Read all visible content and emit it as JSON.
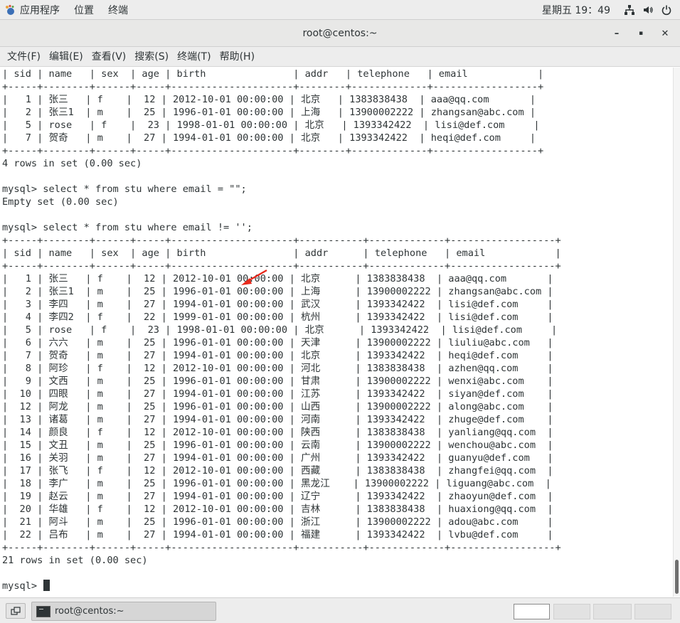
{
  "topbar": {
    "apps_label": "应用程序",
    "places_label": "位置",
    "terminal_label": "终端",
    "clock": "星期五 19：49"
  },
  "window": {
    "title": "root@centos:~",
    "minimize": "–",
    "maximize": "▪",
    "close": "✕"
  },
  "menubar": {
    "items": [
      "文件(F)",
      "编辑(E)",
      "查看(V)",
      "搜索(S)",
      "终端(T)",
      "帮助(H)"
    ]
  },
  "terminal": {
    "lines": [
      "| sid | name   | sex  | age | birth               | addr   | telephone   | email            |",
      "+-----+--------+------+-----+---------------------+--------+-------------+------------------+",
      "|   1 | 张三   | f    |  12 | 2012-10-01 00:00:00 | 北京   | 1383838438  | aaa@qq.com       |",
      "|   2 | 张三1  | m    |  25 | 1996-01-01 00:00:00 | 上海   | 13900002222 | zhangsan@abc.com |",
      "|   5 | rose   | f    |  23 | 1998-01-01 00:00:00 | 北京   | 1393342422  | lisi@def.com     |",
      "|   7 | 贺奇   | m    |  27 | 1994-01-01 00:00:00 | 北京   | 1393342422  | heqi@def.com     |",
      "+-----+--------+------+-----+---------------------+--------+-------------+------------------+",
      "4 rows in set (0.00 sec)",
      "",
      "mysql> select * from stu where email = \"\";",
      "Empty set (0.00 sec)",
      "",
      "mysql> select * from stu where email != '';",
      "+-----+--------+------+-----+---------------------+-----------+-------------+------------------+",
      "| sid | name   | sex  | age | birth               | addr      | telephone   | email            |",
      "+-----+--------+------+-----+---------------------+-----------+-------------+------------------+",
      "|   1 | 张三   | f    |  12 | 2012-10-01 00:00:00 | 北京      | 1383838438  | aaa@qq.com       |",
      "|   2 | 张三1  | m    |  25 | 1996-01-01 00:00:00 | 上海      | 13900002222 | zhangsan@abc.com |",
      "|   3 | 李四   | m    |  27 | 1994-01-01 00:00:00 | 武汉      | 1393342422  | lisi@def.com     |",
      "|   4 | 李四2  | f    |  22 | 1999-01-01 00:00:00 | 杭州      | 1393342422  | lisi@def.com     |",
      "|   5 | rose   | f    |  23 | 1998-01-01 00:00:00 | 北京      | 1393342422  | lisi@def.com     |",
      "|   6 | 六六   | m    |  25 | 1996-01-01 00:00:00 | 天津      | 13900002222 | liuliu@abc.com   |",
      "|   7 | 贺奇   | m    |  27 | 1994-01-01 00:00:00 | 北京      | 1393342422  | heqi@def.com     |",
      "|   8 | 阿珍   | f    |  12 | 2012-10-01 00:00:00 | 河北      | 1383838438  | azhen@qq.com     |",
      "|   9 | 文西   | m    |  25 | 1996-01-01 00:00:00 | 甘肃      | 13900002222 | wenxi@abc.com    |",
      "|  10 | 四眼   | m    |  27 | 1994-01-01 00:00:00 | 江苏      | 1393342422  | siyan@def.com    |",
      "|  12 | 阿龙   | m    |  25 | 1996-01-01 00:00:00 | 山西      | 13900002222 | along@abc.com    |",
      "|  13 | 诸葛   | m    |  27 | 1994-01-01 00:00:00 | 河南      | 1393342422  | zhuge@def.com    |",
      "|  14 | 颜良   | f    |  12 | 2012-10-01 00:00:00 | 陕西      | 1383838438  | yanliang@qq.com  |",
      "|  15 | 文丑   | m    |  25 | 1996-01-01 00:00:00 | 云南      | 13900002222 | wenchou@abc.com  |",
      "|  16 | 关羽   | m    |  27 | 1994-01-01 00:00:00 | 广州      | 1393342422  | guanyu@def.com   |",
      "|  17 | 张飞   | f    |  12 | 2012-10-01 00:00:00 | 西藏      | 1383838438  | zhangfei@qq.com  |",
      "|  18 | 李广   | m    |  25 | 1996-01-01 00:00:00 | 黑龙江    | 13900002222 | liguang@abc.com  |",
      "|  19 | 赵云   | m    |  27 | 1994-01-01 00:00:00 | 辽宁      | 1393342422  | zhaoyun@def.com  |",
      "|  20 | 华雄   | f    |  12 | 2012-10-01 00:00:00 | 吉林      | 1383838438  | huaxiong@qq.com  |",
      "|  21 | 阿斗   | m    |  25 | 1996-01-01 00:00:00 | 浙江      | 13900002222 | adou@abc.com     |",
      "|  22 | 吕布   | m    |  27 | 1994-01-01 00:00:00 | 福建      | 1393342422  | lvbu@def.com     |",
      "+-----+--------+------+-----+---------------------+-----------+-------------+------------------+",
      "21 rows in set (0.00 sec)",
      ""
    ],
    "prompt": "mysql> "
  },
  "taskbar": {
    "task_label": "root@centos:~"
  },
  "colors": {
    "annotation_arrow": "#e8291c",
    "panel_bg": "#ededed",
    "text": "#2e3436"
  }
}
